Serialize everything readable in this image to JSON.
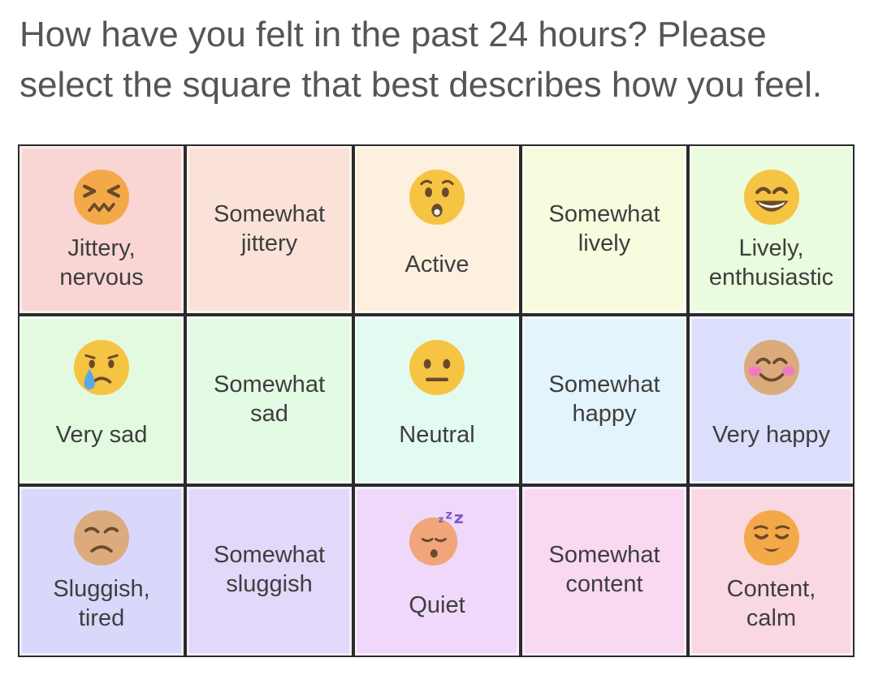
{
  "question": "How have you felt in the past 24 hours? Please select the square that best describes how you feel.",
  "colors": {
    "text": "#3e3e3e",
    "question_text": "#555555",
    "cell_border": "#2b2b2b",
    "emoji_yellow": "#f6c443",
    "emoji_orange": "#f4a949",
    "emoji_tan": "#dbab7d"
  },
  "grid": {
    "rows": [
      {
        "cells": [
          {
            "label": "Jittery,\nnervous",
            "bg": "#f9d6d3",
            "icon": "confounded-face-icon"
          },
          {
            "label": "Somewhat\njittery",
            "bg": "#fae2d8",
            "icon": ""
          },
          {
            "label": "Active",
            "bg": "#fdf0de",
            "icon": "hushed-face-icon"
          },
          {
            "label": "Somewhat\nlively",
            "bg": "#f9fbdf",
            "icon": ""
          },
          {
            "label": "Lively,\nenthusiastic",
            "bg": "#e9fcdd",
            "icon": "grinning-face-icon"
          }
        ]
      },
      {
        "cells": [
          {
            "label": "Very sad",
            "bg": "#e3fae1",
            "icon": "crying-face-icon"
          },
          {
            "label": "Somewhat\nsad",
            "bg": "#e3fae4",
            "icon": ""
          },
          {
            "label": "Neutral",
            "bg": "#e3faf1",
            "icon": "neutral-face-icon"
          },
          {
            "label": "Somewhat\nhappy",
            "bg": "#e3f4fc",
            "icon": ""
          },
          {
            "label": "Very happy",
            "bg": "#dcdffb",
            "icon": "smiling-face-icon"
          }
        ]
      },
      {
        "cells": [
          {
            "label": "Sluggish,\ntired",
            "bg": "#d9d8fa",
            "icon": "disappointed-face-icon"
          },
          {
            "label": "Somewhat\nsluggish",
            "bg": "#e2d8fa",
            "icon": ""
          },
          {
            "label": "Quiet",
            "bg": "#f0d8fa",
            "icon": "sleeping-face-icon"
          },
          {
            "label": "Somewhat\ncontent",
            "bg": "#f9d8f2",
            "icon": ""
          },
          {
            "label": "Content,\ncalm",
            "bg": "#f9d8e2",
            "icon": "relieved-face-icon"
          }
        ]
      }
    ]
  }
}
